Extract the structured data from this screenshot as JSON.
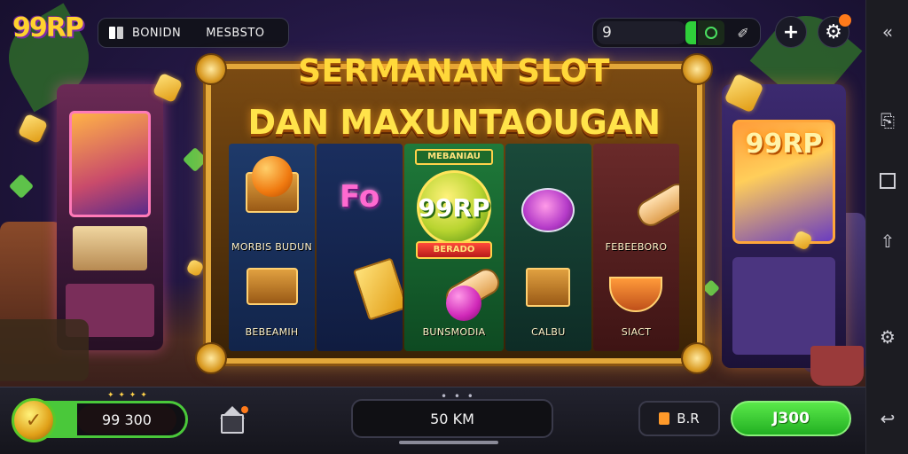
{
  "header": {
    "logo": "99RP",
    "nav_left_label": "BONIDN",
    "nav_right_label": "MESBSTO",
    "search_value": "9",
    "notification_count": ""
  },
  "game": {
    "title_line1": "SERMANAN SLOT",
    "title_line2": "DAN MAXUNTAOUGAN",
    "reels": [
      {
        "symbols": [
          "orange-fruit-box",
          "dynamite-crate"
        ],
        "captions": [
          "MORBIS BUDUN",
          "BEBEAMIH"
        ]
      },
      {
        "symbols": [
          "fo-text",
          "gold-bar"
        ],
        "captions": [
          "",
          ""
        ]
      },
      {
        "symbols": [
          "99rp-coin",
          "sword-orb"
        ],
        "captions": [
          "",
          "BUNSMODIA"
        ],
        "top_banner": "MEBANIAU",
        "coin_text": "99RP",
        "banner": "BERADO"
      },
      {
        "symbols": [
          "pink-disc",
          "treasure-crate"
        ],
        "captions": [
          "",
          "CALBU"
        ]
      },
      {
        "symbols": [
          "scroll-roll",
          "fruit-bowl"
        ],
        "captions": [
          "FEBEEBORO",
          "SIACT"
        ]
      }
    ],
    "background_cabinet_text": "99RP"
  },
  "footer": {
    "balance": "99 300",
    "bet": "50 KM",
    "auto_label": "B.R",
    "spin_label": "J300",
    "page_dots": "• • •"
  },
  "colors": {
    "accent_gold": "#ffd83a",
    "spin_green": "#2fcf3a",
    "frame_gold": "#e3a83a"
  },
  "icons": {
    "right_nav": [
      "double-chevron-left-icon",
      "login-icon",
      "square-icon",
      "share-icon",
      "settings-cog-icon",
      "back-arrow-icon"
    ]
  }
}
